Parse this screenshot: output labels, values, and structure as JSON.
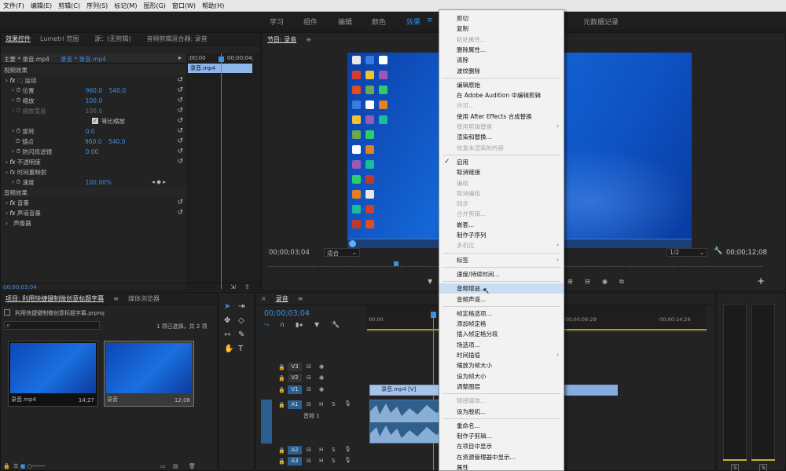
{
  "menubar": [
    "文件(F)",
    "编辑(E)",
    "剪辑(C)",
    "序列(S)",
    "标记(M)",
    "图形(G)",
    "窗口(W)",
    "帮助(H)"
  ],
  "workspaces": {
    "tabs": [
      "学习",
      "组件",
      "编辑",
      "颜色",
      "效果"
    ],
    "active": "效果",
    "right_tab": "元数据记录",
    "accent": "#2d8ceb"
  },
  "effect_controls": {
    "tabs": [
      "效果控件",
      "Lumetri 范围",
      "源：(无剪辑)",
      "音频剪辑混合器: 录音"
    ],
    "master_label": "主要 * 录音.mp4",
    "clip_label": "录音 * 录音.mp4",
    "video_effects": "视频效果",
    "motion": "运动",
    "position": {
      "label": "位置",
      "x": "960.0",
      "y": "540.0"
    },
    "scale": {
      "label": "缩放",
      "value": "100.0"
    },
    "scale_width": {
      "label": "缩放宽度",
      "value": "100.0"
    },
    "uniform_scale": "等比缩放",
    "rotation": {
      "label": "旋转",
      "value": "0.0"
    },
    "anchor": {
      "label": "锚点",
      "x": "960.0",
      "y": "540.0"
    },
    "anti_flicker": {
      "label": "防闪烁滤镜",
      "value": "0.00"
    },
    "opacity": "不透明度",
    "time_remap": "时间重映射",
    "speed": {
      "label": "速度",
      "value": "100.00%"
    },
    "audio_effects": "音频效果",
    "volume": "音量",
    "channel_volume": "声道音量",
    "panner": "声像器",
    "mini_timeline": {
      "start": ";00;00",
      "end": "00;00;04;",
      "clip": "录音.mp4"
    },
    "timecode": "00;00;03;04"
  },
  "program_monitor": {
    "title": "节目: 录音",
    "timecode": "00;00;03;04",
    "fit": "适合",
    "quality": "1/2",
    "duration": "00;00;12;08"
  },
  "project": {
    "tabs": [
      "项目: 利用快捷键制做创意标题字幕",
      "媒体浏览器"
    ],
    "file": "利用快捷键制做创意标题字幕.prproj",
    "selection": "1 项已选择，共 2 项",
    "items": [
      {
        "name": "录音.mp4",
        "duration": "14;27"
      },
      {
        "name": "录音",
        "duration": "12;08"
      }
    ]
  },
  "timeline": {
    "tab": "录音",
    "timecode": "00;00;03;04",
    "ruler": [
      "00;00",
      "00;00;09;29",
      "00;00;14;29"
    ],
    "tracks": [
      "V3",
      "V2",
      "V1",
      "A1",
      "A2",
      "A3"
    ],
    "audio_track_name": "音频 1",
    "track_buttons": {
      "h": "H",
      "s": "S"
    },
    "clip_name": "录音.mp4 [V]"
  },
  "context_menu": {
    "items": [
      {
        "label": "剪切",
        "disabled": false
      },
      {
        "label": "复制",
        "disabled": false
      },
      {
        "label": "粘贴属性...",
        "disabled": true
      },
      {
        "label": "删除属性...",
        "disabled": false
      },
      {
        "label": "清除",
        "disabled": false
      },
      {
        "label": "波纹删除",
        "disabled": false
      },
      {
        "sep": true
      },
      {
        "label": "编辑原始",
        "disabled": false
      },
      {
        "label": "在 Adobe Audition 中编辑剪辑",
        "disabled": false
      },
      {
        "label": "许可...",
        "disabled": true
      },
      {
        "label": "使用 After Effects 合成替换",
        "disabled": false
      },
      {
        "label": "使用剪辑替换",
        "disabled": true,
        "submenu": true
      },
      {
        "label": "渲染和替换...",
        "disabled": false
      },
      {
        "label": "恢复未渲染的内容",
        "disabled": true
      },
      {
        "sep": true
      },
      {
        "label": "启用",
        "disabled": false,
        "checked": true
      },
      {
        "label": "取消链接",
        "disabled": false
      },
      {
        "label": "编组",
        "disabled": true
      },
      {
        "label": "取消编组",
        "disabled": true
      },
      {
        "label": "同步",
        "disabled": true
      },
      {
        "label": "合并剪辑...",
        "disabled": true
      },
      {
        "label": "嵌套...",
        "disabled": false
      },
      {
        "label": "制作子序列",
        "disabled": false
      },
      {
        "label": "多机位",
        "disabled": true,
        "submenu": true
      },
      {
        "sep": true
      },
      {
        "label": "标签",
        "disabled": false,
        "submenu": true
      },
      {
        "sep": true
      },
      {
        "label": "速度/持续时间...",
        "disabled": false
      },
      {
        "sep": true
      },
      {
        "label": "音频增益...",
        "disabled": false,
        "highlighted": true
      },
      {
        "label": "音频声道...",
        "disabled": false
      },
      {
        "sep": true
      },
      {
        "label": "帧定格选项...",
        "disabled": false
      },
      {
        "label": "添加帧定格",
        "disabled": false
      },
      {
        "label": "插入帧定格分段",
        "disabled": false
      },
      {
        "label": "场选项...",
        "disabled": false
      },
      {
        "label": "时间插值",
        "disabled": false,
        "submenu": true
      },
      {
        "label": "缩放为帧大小",
        "disabled": false
      },
      {
        "label": "设为帧大小",
        "disabled": false
      },
      {
        "label": "调整图层",
        "disabled": false
      },
      {
        "sep": true
      },
      {
        "label": "链接媒体...",
        "disabled": true
      },
      {
        "label": "设为脱机...",
        "disabled": false
      },
      {
        "sep": true
      },
      {
        "label": "重命名...",
        "disabled": false
      },
      {
        "label": "制作子剪辑...",
        "disabled": false
      },
      {
        "label": "在项目中显示",
        "disabled": false
      },
      {
        "label": "在资源管理器中显示...",
        "disabled": false
      },
      {
        "label": "属性",
        "disabled": false
      }
    ]
  },
  "meters": {
    "left": "S",
    "right": "S"
  }
}
